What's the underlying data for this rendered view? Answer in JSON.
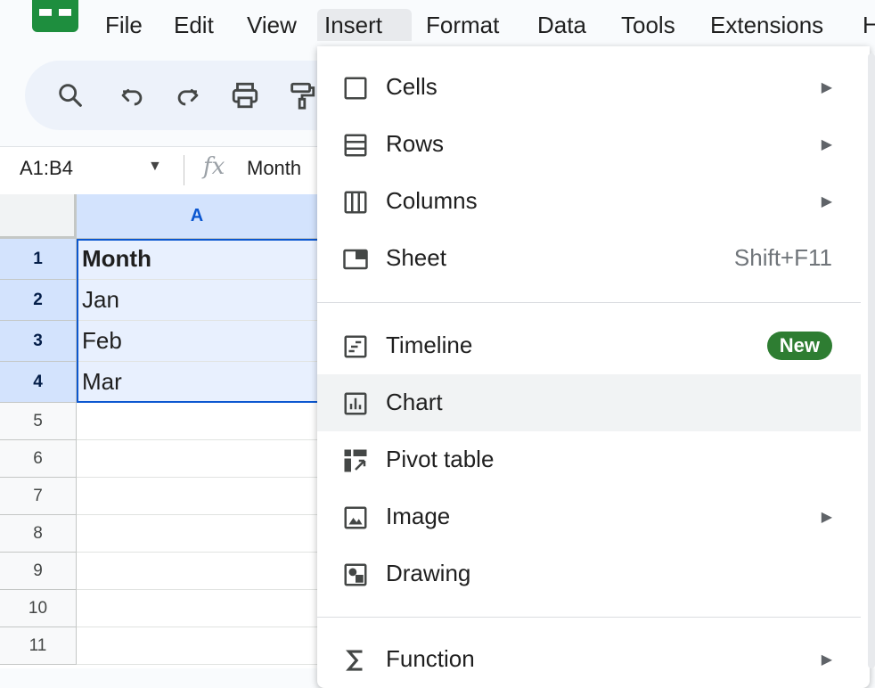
{
  "menubar": {
    "items": [
      "File",
      "Edit",
      "View",
      "Insert",
      "Format",
      "Data",
      "Tools",
      "Extensions",
      "H"
    ],
    "active": "Insert"
  },
  "toolbar": {
    "icons": [
      "search-icon",
      "undo-icon",
      "redo-icon",
      "print-icon",
      "paint-format-icon"
    ]
  },
  "formula_bar": {
    "name_box": "A1:B4",
    "fx": "fx",
    "value": "Month"
  },
  "sheet": {
    "column_header": "A",
    "rows": [
      {
        "num": "1",
        "a": "Month"
      },
      {
        "num": "2",
        "a": "Jan"
      },
      {
        "num": "3",
        "a": "Feb"
      },
      {
        "num": "4",
        "a": "Mar"
      },
      {
        "num": "5",
        "a": ""
      },
      {
        "num": "6",
        "a": ""
      },
      {
        "num": "7",
        "a": ""
      },
      {
        "num": "8",
        "a": ""
      },
      {
        "num": "9",
        "a": ""
      },
      {
        "num": "10",
        "a": ""
      },
      {
        "num": "11",
        "a": ""
      }
    ]
  },
  "insert_menu": {
    "items": [
      {
        "label": "Cells",
        "icon": "cells-icon",
        "arrow": "▶"
      },
      {
        "label": "Rows",
        "icon": "rows-icon",
        "arrow": "▶"
      },
      {
        "label": "Columns",
        "icon": "columns-icon",
        "arrow": "▶"
      },
      {
        "label": "Sheet",
        "icon": "sheet-icon",
        "shortcut": "Shift+F11"
      },
      {
        "label": "Timeline",
        "icon": "timeline-icon",
        "badge": "New"
      },
      {
        "label": "Chart",
        "icon": "chart-icon"
      },
      {
        "label": "Pivot table",
        "icon": "pivot-table-icon"
      },
      {
        "label": "Image",
        "icon": "image-icon",
        "arrow": "▶"
      },
      {
        "label": "Drawing",
        "icon": "drawing-icon"
      },
      {
        "label": "Function",
        "icon": "function-icon",
        "arrow": "▶"
      }
    ],
    "hovered": "Chart"
  },
  "colors": {
    "accent": "#0b57d0",
    "selection": "#d3e3fd",
    "badge": "#2e7d32",
    "logo": "#1e8e3e"
  }
}
